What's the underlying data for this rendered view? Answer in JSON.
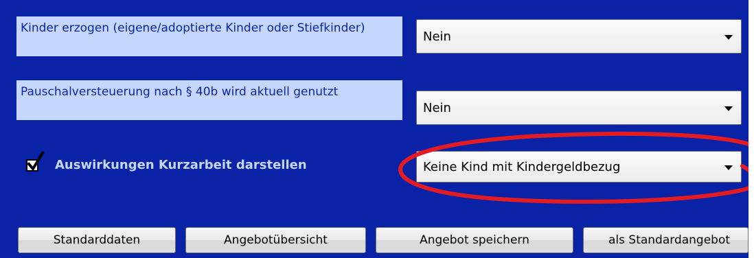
{
  "form": {
    "row1": {
      "label": "Kinder erzogen (eigene/adoptierte Kinder oder Stiefkinder)",
      "select_value": "Nein"
    },
    "row2": {
      "label": "Pauschalversteuerung nach § 40b wird aktuell genutzt",
      "select_value": "Nein"
    },
    "row3": {
      "checkbox_label": "Auswirkungen Kurzarbeit darstellen",
      "checked": true,
      "select_value": "Keine Kind mit Kindergeldbezug"
    }
  },
  "buttons": {
    "standarddaten": "Standarddaten",
    "angebotuebersicht": "Angebotübersicht",
    "angebot_speichern": "Angebot speichern",
    "als_standardangebot": "als Standardangebot"
  },
  "colors": {
    "panel_background": "#0a23a6",
    "label_background": "#c5d7ff",
    "annotation_red": "#e31b23"
  },
  "icons": {
    "dropdown": "chevron-down-icon",
    "checkbox": "check-icon"
  }
}
